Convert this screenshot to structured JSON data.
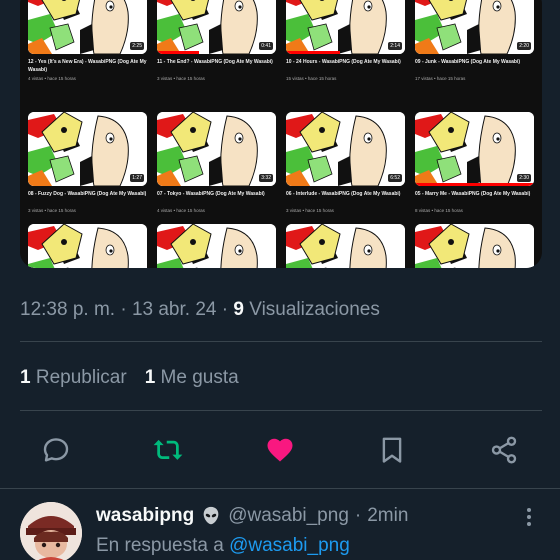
{
  "media": {
    "videos": [
      {
        "title": "12 - Yes (It's a New Era) - WasabiPNG (Dog Ate My Wasabi)",
        "meta": "4 vistas • hace 15 horas",
        "duration": "2:25",
        "progress": 0
      },
      {
        "title": "11 - The End? - WasabiPNG (Dog Ate My Wasabi)",
        "meta": "3 vistas • hace 15 horas",
        "duration": "0:41",
        "progress": 0.35
      },
      {
        "title": "10 - 24 Hours - WasabiPNG (Dog Ate My Wasabi)",
        "meta": "15 vistas • hace 15 horas",
        "duration": "2:14",
        "progress": 0.45
      },
      {
        "title": "09 - Junk - WasabiPNG (Dog Ate My Wasabi)",
        "meta": "17 vistas • hace 15 horas",
        "duration": "2:20",
        "progress": 0
      },
      {
        "title": "08 - Fuzzy Dog - WasabiPNG (Dog Ate My Wasabi)",
        "meta": "3 vistas • hace 15 horas",
        "duration": "1:27",
        "progress": 0
      },
      {
        "title": "07 - Tokyo - WasabiPNG (Dog Ate My Wasabi)",
        "meta": "4 vistas • hace 15 horas",
        "duration": "3:32",
        "progress": 0
      },
      {
        "title": "06 - Interlude - WasabiPNG (Dog Ate My Wasabi)",
        "meta": "3 vistas • hace 15 horas",
        "duration": "6:52",
        "progress": 0
      },
      {
        "title": "05 - Marry Me - WasabiPNG (Dog Ate My Wasabi)",
        "meta": "8 vistas • hace 15 horas",
        "duration": "2:30",
        "progress": 1
      },
      {
        "title": "",
        "meta": "",
        "duration": "",
        "progress": 0
      },
      {
        "title": "",
        "meta": "",
        "duration": "",
        "progress": 0
      },
      {
        "title": "",
        "meta": "",
        "duration": "",
        "progress": 0
      },
      {
        "title": "",
        "meta": "",
        "duration": "",
        "progress": 0
      }
    ]
  },
  "tweet": {
    "time": "12:38 p. m.",
    "date": "13 abr. 24",
    "separator": "·",
    "views_count": "9",
    "views_label": "Visualizaciones",
    "reposts_count": "1",
    "reposts_label": "Republicar",
    "likes_count": "1",
    "likes_label": "Me gusta"
  },
  "actions": {
    "reply_icon": "speech-bubble-icon",
    "retweet_icon": "retweet-icon",
    "like_icon": "heart-icon",
    "bookmark_icon": "bookmark-icon",
    "share_icon": "share-icon"
  },
  "reply": {
    "name": "wasabipng",
    "emoji": "alien-icon",
    "handle": "@wasabi_png",
    "separator": "·",
    "time": "2min",
    "in_reply_prefix": "En respuesta a",
    "in_reply_mention": "@wasabi_png"
  },
  "colors": {
    "background": "#15202b",
    "retweet_active": "#00ba7c",
    "like_active": "#f91880",
    "link": "#1d9bf0",
    "muted": "#8b98a5"
  }
}
